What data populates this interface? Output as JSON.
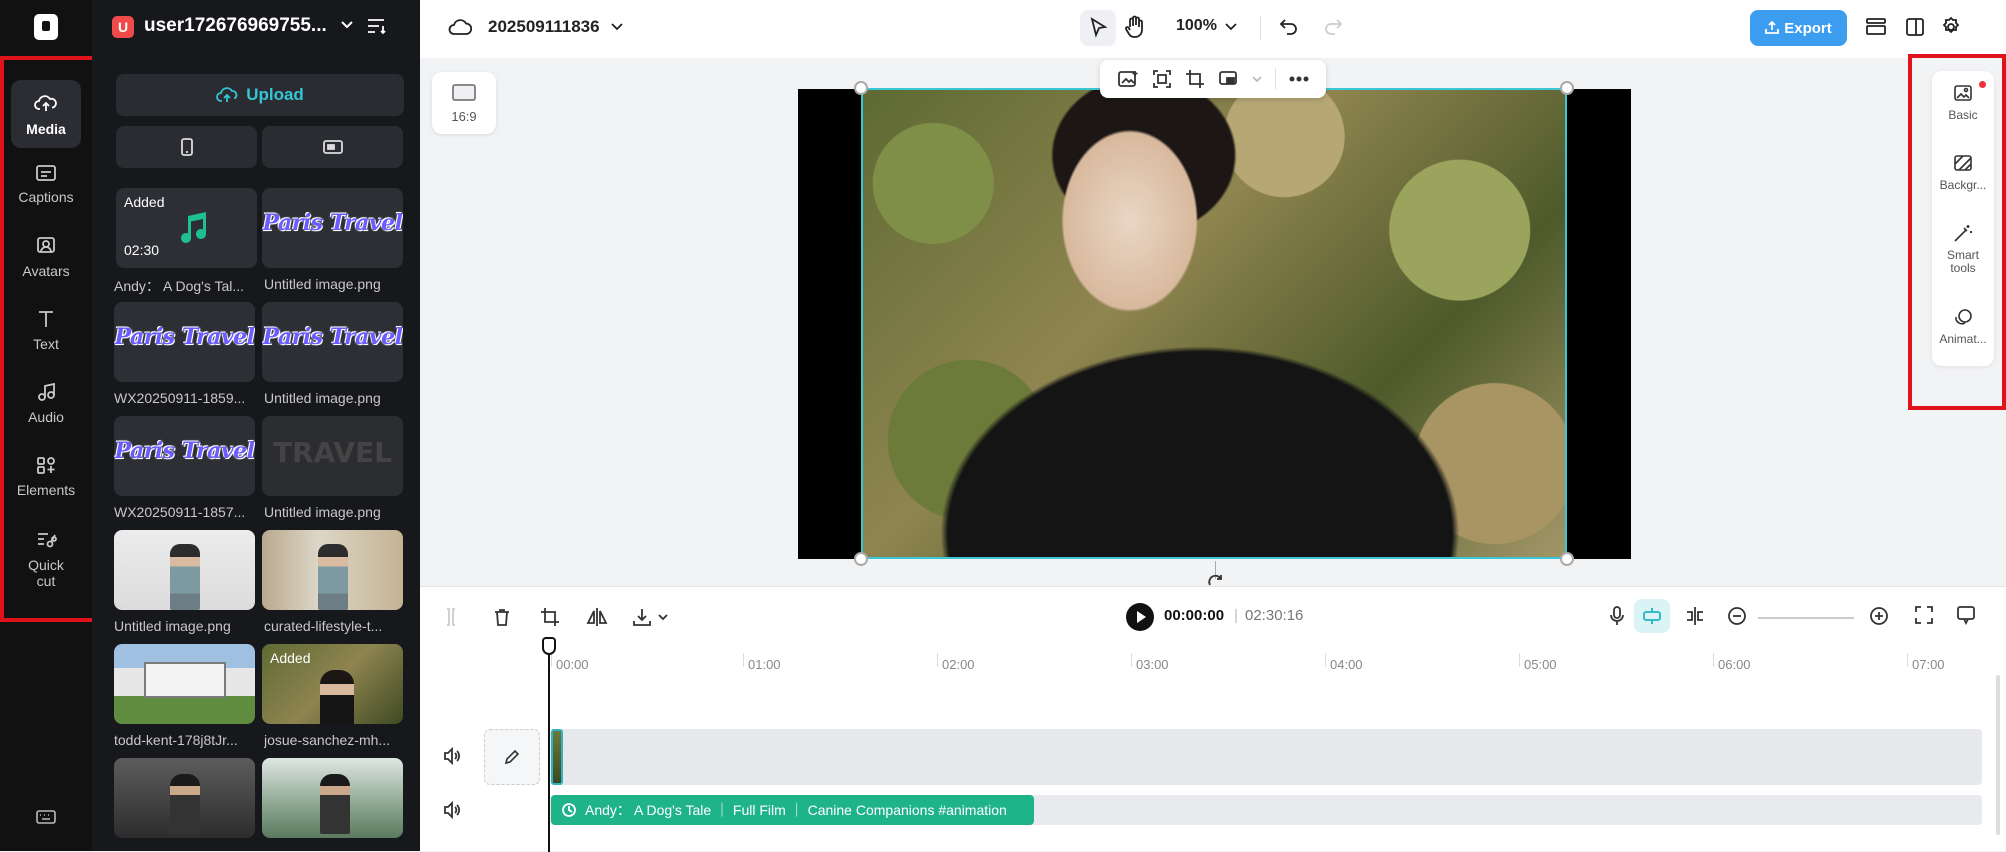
{
  "left_nav": {
    "items": [
      {
        "label": "Media",
        "icon": "cloud-upload-icon"
      },
      {
        "label": "Captions",
        "icon": "captions-icon"
      },
      {
        "label": "Avatars",
        "icon": "avatar-icon"
      },
      {
        "label": "Text",
        "icon": "text-icon"
      },
      {
        "label": "Audio",
        "icon": "music-note-icon"
      },
      {
        "label": "Elements",
        "icon": "elements-icon"
      },
      {
        "label": "Quick cut",
        "icon": "scissors-icon"
      }
    ],
    "keyboard_icon": "keyboard-icon"
  },
  "panel": {
    "user_initial": "U",
    "username": "user172676969755...",
    "upload_label": "Upload",
    "media": [
      {
        "label": "Andy： A Dog's Tal...",
        "badge": "Added",
        "duration": "02:30",
        "kind": "audio"
      },
      {
        "label": "Untitled image.png",
        "kind": "paris"
      },
      {
        "label": "WX20250911-1859...",
        "kind": "paris"
      },
      {
        "label": "Untitled image.png",
        "kind": "paris"
      },
      {
        "label": "WX20250911-1857...",
        "kind": "paris"
      },
      {
        "label": "Untitled image.png",
        "kind": "travel"
      },
      {
        "label": "Untitled image.png",
        "kind": "photo"
      },
      {
        "label": "curated-lifestyle-t...",
        "kind": "photo"
      },
      {
        "label": "todd-kent-178j8tJr...",
        "kind": "photo"
      },
      {
        "label": "josue-sanchez-mh...",
        "badge": "Added",
        "kind": "photo"
      },
      {
        "label": "",
        "kind": "photo"
      },
      {
        "label": "",
        "kind": "photo"
      }
    ],
    "paris_text": "Paris Travel",
    "travel_text": "TRAVEL"
  },
  "topbar": {
    "project_name": "202509111836",
    "zoom": "100%",
    "export_label": "Export"
  },
  "canvas": {
    "ratio_label": "16:9"
  },
  "right_panel": {
    "items": [
      {
        "label": "Basic",
        "icon": "image-icon"
      },
      {
        "label": "Backgr...",
        "icon": "background-icon"
      },
      {
        "label": "Smart tools",
        "icon": "magic-wand-icon"
      },
      {
        "label": "Animat...",
        "icon": "animation-icon"
      }
    ]
  },
  "timeline": {
    "current_time": "00:00:00",
    "separator": "|",
    "total_time": "02:30:16",
    "ticks": [
      "00:00",
      "01:00",
      "02:00",
      "03:00",
      "04:00",
      "05:00",
      "06:00",
      "07:00"
    ],
    "audio_clip_label": "Andy： A Dog's Tale ｜ Full Film ｜ Canine Companions #animation"
  }
}
